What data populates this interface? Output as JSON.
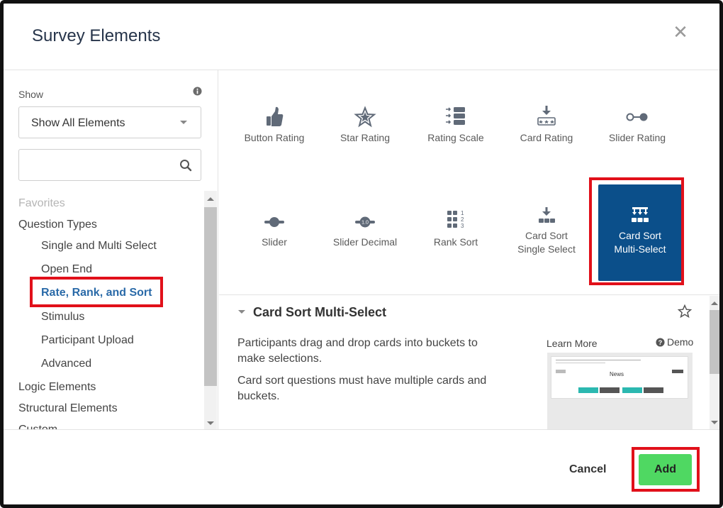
{
  "dialog": {
    "title": "Survey Elements"
  },
  "sidebar": {
    "show_label": "Show",
    "filter_value": "Show All Elements",
    "search_placeholder": "",
    "nav": {
      "favorites": "Favorites",
      "question_types": "Question Types",
      "single_multi": "Single and Multi Select",
      "open_end": "Open End",
      "rate_rank_sort": "Rate, Rank, and Sort",
      "stimulus": "Stimulus",
      "participant_upload": "Participant Upload",
      "advanced": "Advanced",
      "logic": "Logic Elements",
      "structural": "Structural Elements",
      "custom": "Custom"
    }
  },
  "tiles": [
    {
      "label": "Button Rating",
      "icon": "thumbs-up-icon"
    },
    {
      "label": "Star Rating",
      "icon": "star-icon"
    },
    {
      "label": "Rating Scale",
      "icon": "rating-scale-icon"
    },
    {
      "label": "Card Rating",
      "icon": "card-rating-icon"
    },
    {
      "label": "Slider Rating",
      "icon": "slider-rating-icon"
    },
    {
      "label": "Slider",
      "icon": "slider-icon"
    },
    {
      "label": "Slider Decimal",
      "icon": "slider-decimal-icon",
      "icon_text": "1.0"
    },
    {
      "label": "Rank Sort",
      "icon": "rank-sort-icon",
      "icon_text": [
        "1",
        "2",
        "3"
      ]
    },
    {
      "label": "Card Sort Single Select",
      "line1": "Card Sort",
      "line2": "Single Select",
      "icon": "card-sort-single-icon"
    },
    {
      "label": "Card Sort Multi-Select",
      "line1": "Card Sort",
      "line2": "Multi-Select",
      "icon": "card-sort-multi-icon",
      "selected": true
    }
  ],
  "detail": {
    "title": "Card Sort Multi-Select",
    "description_1": "Participants drag and drop cards into buckets to make selections.",
    "description_2": "Card sort questions must have multiple cards and buckets.",
    "learn_more": "Learn More",
    "demo": "Demo",
    "preview_title": "News"
  },
  "footer": {
    "cancel": "Cancel",
    "add": "Add"
  },
  "colors": {
    "selected_tile": "#0b4f8a",
    "add_button": "#4fd862",
    "highlight": "#e1101a",
    "active_nav": "#2a6aa8"
  }
}
